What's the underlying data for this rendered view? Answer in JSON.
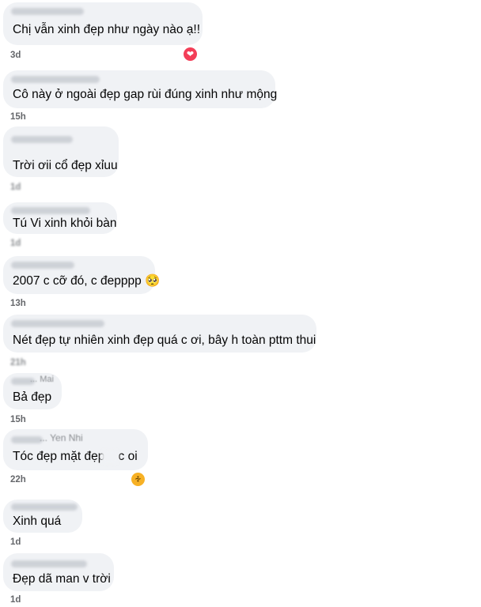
{
  "comments": [
    {
      "text": "Chị vẫn xinh đẹp như ngày nào ạ!!",
      "time": "3d",
      "reaction": "love-icon"
    },
    {
      "text": "Cô này ở ngoài đẹp gap rùi đúng xinh như mộng",
      "time": "15h"
    },
    {
      "text": "Trời ơii cổ đẹp xỉuu",
      "time": "1d"
    },
    {
      "text": "Tú Vi xinh khỏi bàn",
      "time": "1d"
    },
    {
      "text": "2007 c cỡ đó, c đepppp 🥺",
      "time": "13h"
    },
    {
      "text": "Nét đẹp tự nhiên xinh đẹp quá c ơi, bây h toàn pttm thui",
      "time": "21h"
    },
    {
      "text": "Bả đẹp",
      "time": "15h",
      "name": "... Mai"
    },
    {
      "text": "Tóc đẹp mặt đẹp... c oi",
      "time": "22h",
      "name": "... Yen Nhi",
      "reaction": "haha-icon"
    },
    {
      "text": "Xinh quá",
      "time": "1d"
    },
    {
      "text": "Đẹp dã man v trời",
      "time": "1d"
    }
  ]
}
